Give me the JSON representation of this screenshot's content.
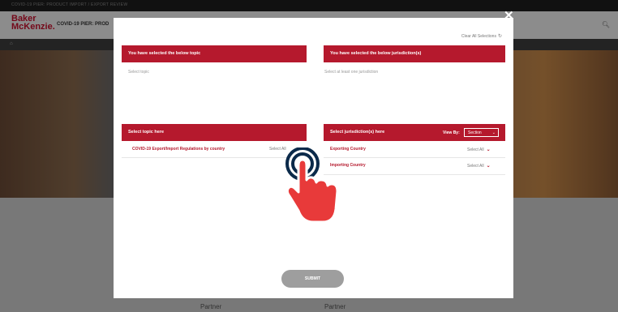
{
  "page": {
    "topbar_text": "COVID-19 PIER: PRODUCT IMPORT / EXPORT REVIEW",
    "logo_line1": "Baker",
    "logo_line2": "McKenzie.",
    "header_title": "COVID-19 PIER: PROD",
    "breadcrumb": "⌂",
    "partner_labels": [
      "Partner",
      "Partner"
    ]
  },
  "modal": {
    "clear_all": "Clear All Selections",
    "topic_selected_header": "You have selected the below topic",
    "topic_selected_hint": "Select topic",
    "jurisdiction_selected_header": "You have selected the below jurisdiction(s)",
    "jurisdiction_selected_hint": "Select at least one jurisdiction",
    "select_topic_header": "Select topic here",
    "topic_row_label": "COVID-19 Export/Import Regulations by country",
    "topic_row_action": "Select All",
    "select_jurisdiction_header": "Select jurisdiction(s) here",
    "view_by_label": "View By:",
    "view_by_value": "Section",
    "jurisdiction_rows": [
      {
        "label": "Exporting Country",
        "action": "Select All"
      },
      {
        "label": "Importing Country",
        "action": "Select All"
      }
    ],
    "submit_label": "SUBMIT"
  },
  "colors": {
    "accent": "#b5192d",
    "submit": "#9e9e9e"
  },
  "icons": {
    "close": "close-icon",
    "hand": "pointer-hand-icon",
    "reset": "reset-icon",
    "chevron": "chevron-down-icon"
  }
}
